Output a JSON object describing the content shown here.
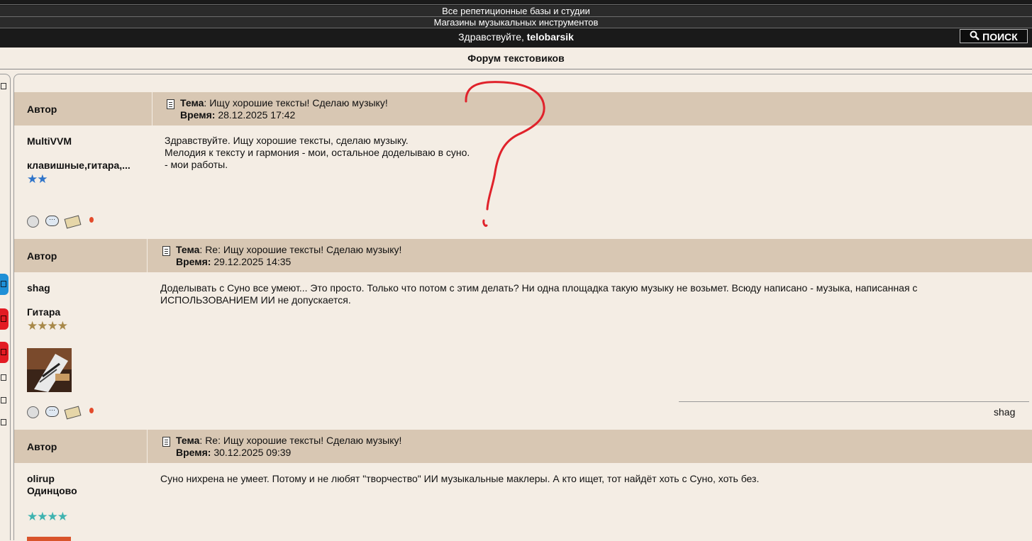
{
  "top_nav": {
    "links": [
      "Все репетиционные базы и студии",
      "Магазины музыкальных инструментов"
    ],
    "greeting": "Здравствуйте, ",
    "username": "telobarsik",
    "search_label": "ПОИСК"
  },
  "forum": {
    "title": "Форум текстовиков"
  },
  "labels": {
    "author": "Автор",
    "topic": "Тема",
    "time": "Время:"
  },
  "posts": [
    {
      "author": "MultiVVM",
      "role": "клавишные,гитара,...",
      "stars": "★★",
      "star_color": "#2f74c9",
      "topic": ": Ищу хорошие тексты! Сделаю музыку!",
      "time": "28.12.2025 17:42",
      "lines": [
        "Здравствуйте. Ищу хорошие тексты, сделаю музыку.",
        "Мелодия к тексту и гармония - мои, остальное доделываю в суно.",
        "- мои работы."
      ]
    },
    {
      "author": "shag",
      "role": "Гитара",
      "stars": "★★★★",
      "star_color": "#a8894a",
      "topic": ": Re: Ищу хорошие тексты! Сделаю музыку!",
      "time": "29.12.2025 14:35",
      "lines": [
        "Доделывать с Суно все умеют... Это просто. Только что потом с этим делать? Ни одна площадка такую музыку не возьмет. Всюду написано - музыка, написанная с",
        "ИСПОЛЬЗОВАНИЕМ ИИ не допускается."
      ],
      "signature": "shag"
    },
    {
      "author": "olirup",
      "role": "Одинцово",
      "stars": "★★★★",
      "star_color": "#3fb3b0",
      "topic": ": Re: Ищу хорошие тексты! Сделаю музыку!",
      "time": "30.12.2025 09:39",
      "lines": [
        "Суно нихрена не умеет. Потому и не любят \"творчество\" ИИ музыкальные маклеры. А кто ищет, тот найдёт хоть с Суно, хоть без."
      ]
    }
  ],
  "colors": {
    "header_bg": "#1a1a1a",
    "page_bg": "#f4ede4",
    "post_header_bg": "#d8c7b3",
    "doodle_red": "#e0222b"
  }
}
